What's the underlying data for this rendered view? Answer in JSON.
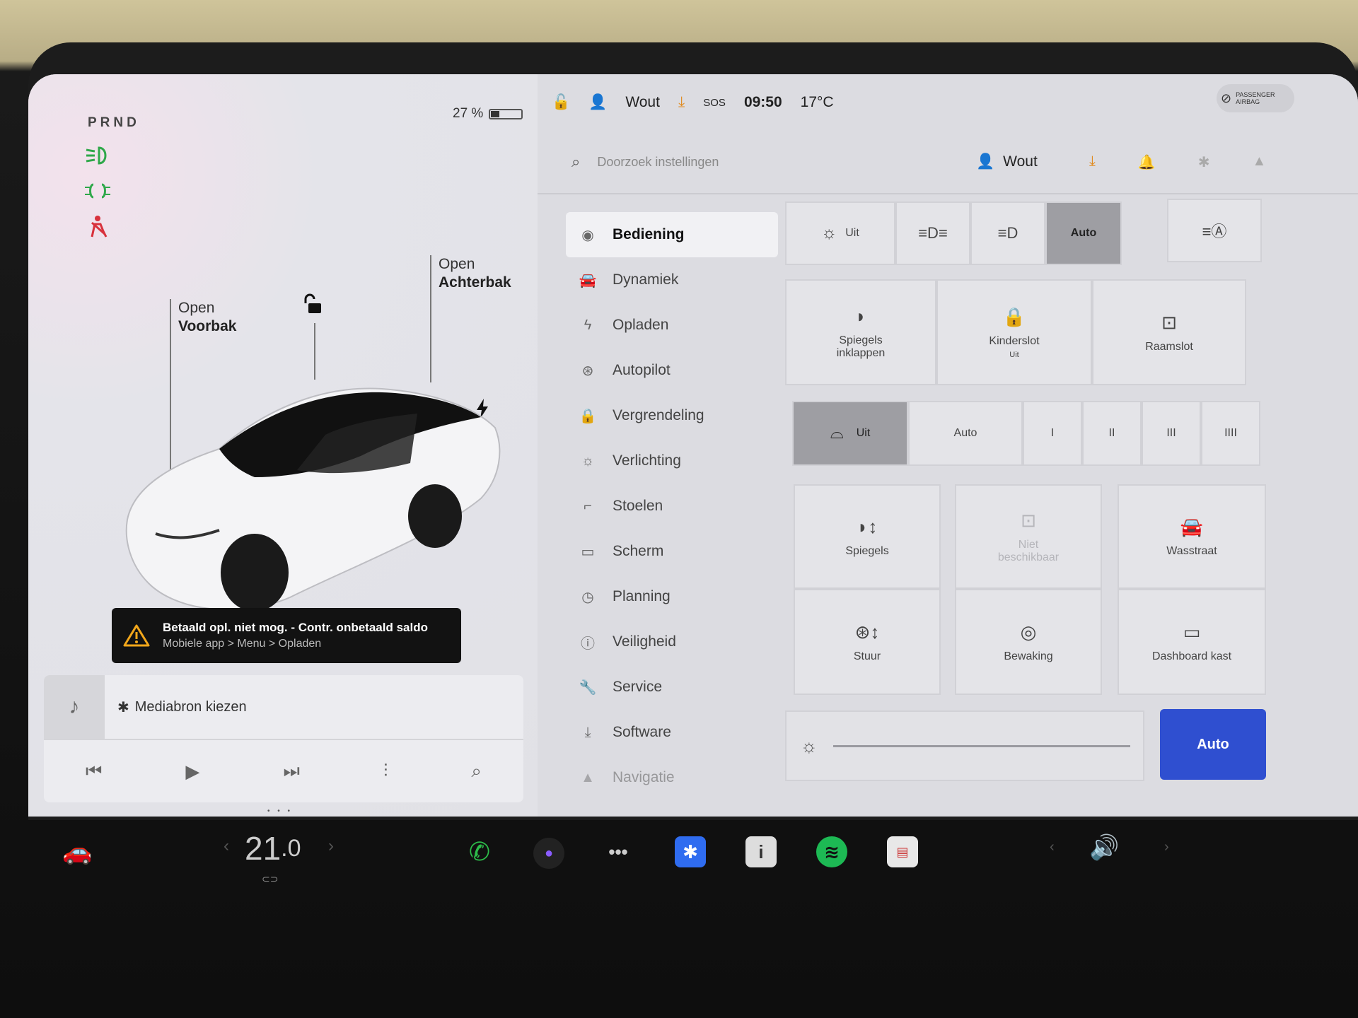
{
  "left": {
    "gear": "PRND",
    "battery_percent": "27 %",
    "battery_level": 0.27,
    "frunk": {
      "line1": "Open",
      "line2": "Voorbak"
    },
    "trunk": {
      "line1": "Open",
      "line2": "Achterbak"
    },
    "alert": {
      "title": "Betaald opl. niet mog. - Contr. onbetaald saldo",
      "subtitle": "Mobiele app > Menu > Opladen"
    },
    "media_source": "Mediabron kiezen"
  },
  "status": {
    "user": "Wout",
    "sos": "SOS",
    "time": "09:50",
    "temp": "17°C",
    "airbag_l1": "PASSENGER",
    "airbag_l2": "AIRBAG"
  },
  "search": {
    "placeholder": "Doorzoek instellingen",
    "user": "Wout"
  },
  "nav": [
    {
      "label": "Bediening",
      "icon": "toggle-icon"
    },
    {
      "label": "Dynamiek",
      "icon": "car-icon"
    },
    {
      "label": "Opladen",
      "icon": "bolt-icon"
    },
    {
      "label": "Autopilot",
      "icon": "steering-wheel-icon"
    },
    {
      "label": "Vergrendeling",
      "icon": "lock-icon"
    },
    {
      "label": "Verlichting",
      "icon": "light-icon"
    },
    {
      "label": "Stoelen",
      "icon": "seat-icon"
    },
    {
      "label": "Scherm",
      "icon": "screen-icon"
    },
    {
      "label": "Planning",
      "icon": "clock-icon"
    },
    {
      "label": "Veiligheid",
      "icon": "alert-circle-icon"
    },
    {
      "label": "Service",
      "icon": "wrench-icon"
    },
    {
      "label": "Software",
      "icon": "download-icon"
    },
    {
      "label": "Navigatie",
      "icon": "navigation-icon"
    }
  ],
  "lights": {
    "off": "Uit",
    "auto": "Auto"
  },
  "tiles1": {
    "mirrors_fold": "Spiegels inklappen",
    "child_lock": "Kinderslot",
    "child_lock_state": "Uit",
    "window_lock": "Raamslot"
  },
  "wipers": {
    "off": "Uit",
    "auto": "Auto",
    "levels": [
      "I",
      "II",
      "III",
      "IIII"
    ]
  },
  "tiles2": {
    "mirrors": "Spiegels",
    "unavailable": "Niet beschikbaar",
    "car_wash": "Wasstraat",
    "wheel": "Stuur",
    "sentry": "Bewaking",
    "glovebox": "Dashboard kast"
  },
  "brightness": {
    "auto": "Auto"
  },
  "dock": {
    "temp_int": "21",
    "temp_dec": ".0"
  }
}
